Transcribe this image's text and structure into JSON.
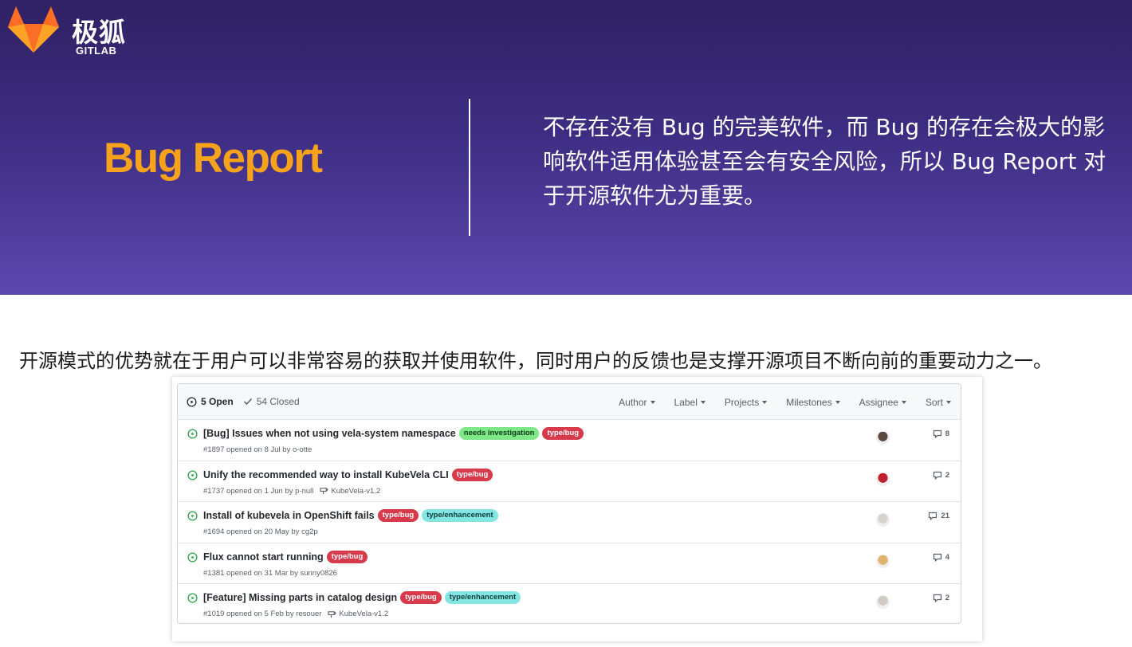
{
  "logo": {
    "cn": "极狐",
    "en": "GITLAB"
  },
  "hero": {
    "title": "Bug Report",
    "description": "不存在没有 Bug 的完美软件，而 Bug 的存在会极大的影响软件适用体验甚至会有安全风险，所以 Bug Report 对于开源软件尤为重要。"
  },
  "paragraph": "开源模式的优势就在于用户可以非常容易的获取并使用软件，同时用户的反馈也是支撑开源项目不断向前的重要动力之一。",
  "issues": {
    "open_label": "5 Open",
    "closed_label": "54 Closed",
    "filters": [
      "Author",
      "Label",
      "Projects",
      "Milestones",
      "Assignee",
      "Sort"
    ],
    "rows": [
      {
        "title": "[Bug] Issues when not using vela-system namespace",
        "labels": [
          {
            "text": "needs investigation",
            "bg": "#7ee787",
            "fg": "#0a3d12"
          },
          {
            "text": "type/bug",
            "bg": "#d73a4a",
            "fg": "#ffffff"
          }
        ],
        "meta": "#1897 opened on 8 Jul by o-otte",
        "milestone": "",
        "comments": "8",
        "avatar_color": "#5b4a3f"
      },
      {
        "title": "Unify the recommended way to install KubeVela CLI",
        "labels": [
          {
            "text": "type/bug",
            "bg": "#d73a4a",
            "fg": "#ffffff"
          }
        ],
        "meta": "#1737 opened on 1 Jun by p-null",
        "milestone": "KubeVela-v1.2",
        "comments": "2",
        "avatar_color": "#c21f32"
      },
      {
        "title": "Install of kubevela in OpenShift fails",
        "labels": [
          {
            "text": "type/bug",
            "bg": "#d73a4a",
            "fg": "#ffffff"
          },
          {
            "text": "type/enhancement",
            "bg": "#84e6e3",
            "fg": "#0b3b3a"
          }
        ],
        "meta": "#1694 opened on 20 May by cg2p",
        "milestone": "",
        "comments": "21",
        "avatar_color": "#d6d2cd"
      },
      {
        "title": "Flux cannot start running",
        "labels": [
          {
            "text": "type/bug",
            "bg": "#d73a4a",
            "fg": "#ffffff"
          }
        ],
        "meta": "#1381 opened on 31 Mar by sunny0826",
        "milestone": "",
        "comments": "4",
        "avatar_color": "#e0b46a"
      },
      {
        "title": "[Feature] Missing parts in catalog design",
        "labels": [
          {
            "text": "type/bug",
            "bg": "#d73a4a",
            "fg": "#ffffff"
          },
          {
            "text": "type/enhancement",
            "bg": "#84e6e3",
            "fg": "#0b3b3a"
          }
        ],
        "meta": "#1019 opened on 5 Feb by resouer",
        "milestone": "KubeVela-v1.2",
        "comments": "2",
        "avatar_color": "#cfcac2"
      }
    ]
  }
}
